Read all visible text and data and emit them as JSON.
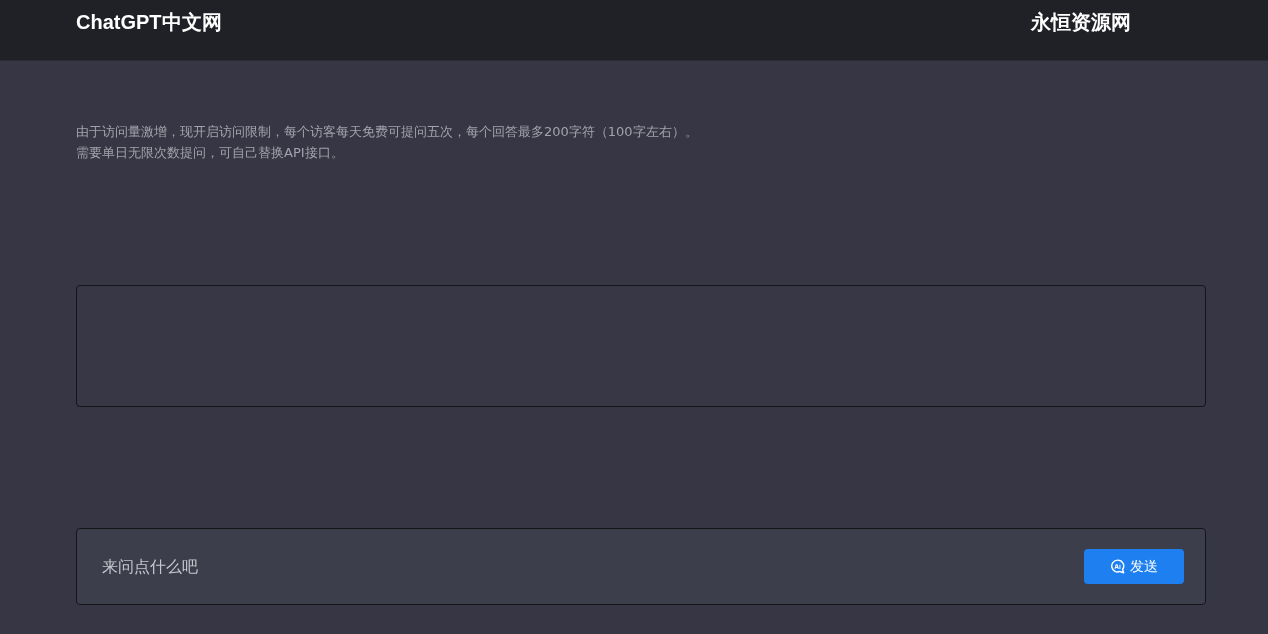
{
  "header": {
    "brand": "ChatGPT中文网",
    "link": "永恒资源网"
  },
  "notice": {
    "lines": [
      "由于访问量激增，现开启访问限制，每个访客每天免费可提问五次，每个回答最多200字符（100字左右）。",
      "需要单日无限次数提问，可自己替换API接口。"
    ]
  },
  "composer": {
    "placeholder": "来问点什么吧",
    "send_button": "发送"
  }
}
